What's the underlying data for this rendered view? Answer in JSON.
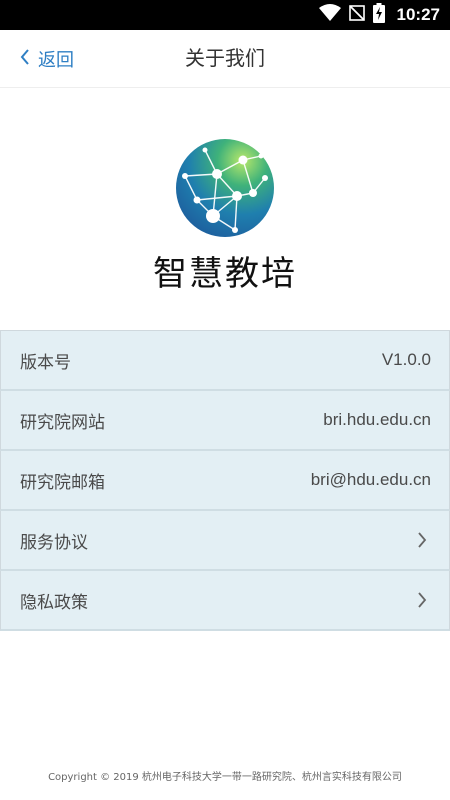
{
  "status_bar": {
    "time": "10:27",
    "icons": [
      "wifi-icon",
      "no-signal-icon",
      "battery-charging-icon"
    ]
  },
  "nav": {
    "back_label": "返回",
    "title": "关于我们"
  },
  "app": {
    "name": "智慧教培",
    "logo_icon": "network-globe-logo",
    "logo_colors": [
      "#2a6fb0",
      "#1fa88a",
      "#7cc84a"
    ]
  },
  "info_list": [
    {
      "label": "版本号",
      "value": "V1.0.0"
    },
    {
      "label": "研究院网站",
      "value": "bri.hdu.edu.cn"
    },
    {
      "label": "研究院邮箱",
      "value": "bri@hdu.edu.cn"
    },
    {
      "label": "服务协议",
      "icon": "chevron-right-icon"
    },
    {
      "label": "隐私政策",
      "icon": "chevron-right-icon"
    }
  ],
  "footer": {
    "copyright": "Copyright © 2019 杭州电子科技大学一带一路研究院、杭州言实科技有限公司"
  }
}
